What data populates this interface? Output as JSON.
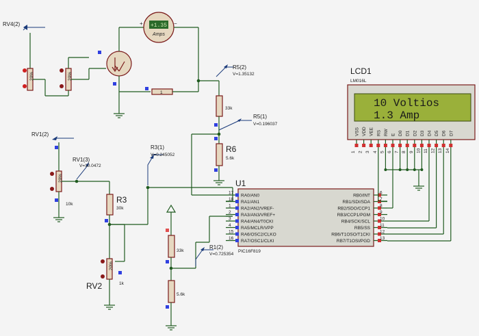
{
  "probes": {
    "rv4": "RV4(2)",
    "rv1": "RV1(2)",
    "rv1_3": "RV1(3)",
    "rv1_3_val": "V=10.0472",
    "r3_1": "R3(1)",
    "r3_1_val": "V=0.245052",
    "r5_2": "R5(2)",
    "r5_2_val": "V=1.35132",
    "r5_1": "R5(1)",
    "r5_1_val": "V=0.196037",
    "r1_2": "R1(2)",
    "r1_2_val": "V=0.725354"
  },
  "ammeter": {
    "reading": "+1.35",
    "unit": "Amps",
    "plus": "+",
    "minus": "−"
  },
  "components": {
    "r1": "1",
    "r6": "R6",
    "r6_value": "5.6k",
    "r6_upper_value": "33k",
    "r3": "R3",
    "r3_value": "30k",
    "rv1_value": "10k",
    "rv2": "RV2",
    "rv2_value": "1k",
    "bottom_r_upper": "33k",
    "bottom_r_lower": "5.6k",
    "pot_mark": "20%"
  },
  "mcu": {
    "ref": "U1",
    "part": "PIC16F819",
    "left_pins": [
      {
        "num": "17",
        "name": "RA0/AN0"
      },
      {
        "num": "18",
        "name": "RA1/AN1"
      },
      {
        "num": "1",
        "name": "RA2/AN2/VREF-"
      },
      {
        "num": "2",
        "name": "RA3/AN3/VREF+"
      },
      {
        "num": "3",
        "name": "RA4/AN4/T0CKI"
      },
      {
        "num": "4",
        "name": "RA5/MCLR/VPP"
      },
      {
        "num": "15",
        "name": "RA6/OSC2/CLKO"
      },
      {
        "num": "16",
        "name": "RA7/OSC1/CLKI"
      }
    ],
    "right_pins": [
      {
        "num": "6",
        "name": "RB0/INT"
      },
      {
        "num": "7",
        "name": "RB1/SDI/SDA"
      },
      {
        "num": "8",
        "name": "RB2/SDO/CCP1"
      },
      {
        "num": "9",
        "name": "RB3/CCP1/PGM"
      },
      {
        "num": "10",
        "name": "RB4/SCK/SCL"
      },
      {
        "num": "11",
        "name": "RB5/SS"
      },
      {
        "num": "12",
        "name": "RB6/T1OSO/T1CKI"
      },
      {
        "num": "13",
        "name": "RB7/T1OSI/PGD"
      }
    ]
  },
  "lcd": {
    "ref": "LCD1",
    "part": "LM016L",
    "line1": "10 Voltios",
    "line2": "1.3 Amp",
    "pins": [
      {
        "name": "VSS",
        "num": "1"
      },
      {
        "name": "VDD",
        "num": "2"
      },
      {
        "name": "VEE",
        "num": "3"
      },
      {
        "name": "RS",
        "num": "4"
      },
      {
        "name": "RW",
        "num": "5"
      },
      {
        "name": "E",
        "num": "6"
      },
      {
        "name": "D0",
        "num": "7"
      },
      {
        "name": "D1",
        "num": "8"
      },
      {
        "name": "D2",
        "num": "9"
      },
      {
        "name": "D3",
        "num": "10"
      },
      {
        "name": "D4",
        "num": "11"
      },
      {
        "name": "D5",
        "num": "12"
      },
      {
        "name": "D6",
        "num": "13"
      },
      {
        "name": "D7",
        "num": "14"
      }
    ]
  }
}
